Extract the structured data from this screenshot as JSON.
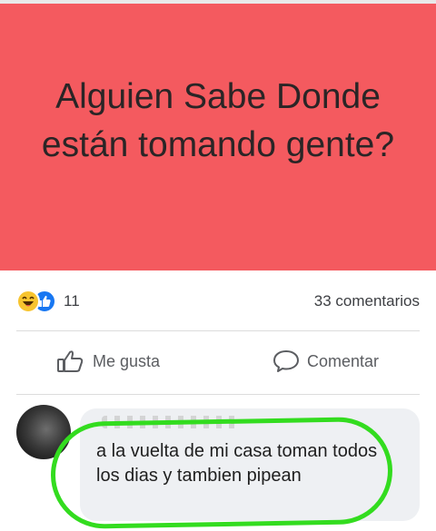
{
  "post": {
    "text": "Alguien Sabe Donde están tomando gente?",
    "background_color": "#f45a5f"
  },
  "stats": {
    "reaction_icons": [
      "haha-icon",
      "like-icon"
    ],
    "reaction_count": "11",
    "comment_count": "33 comentarios"
  },
  "actions": {
    "like_label": "Me gusta",
    "comment_label": "Comentar"
  },
  "comment": {
    "text": "a la vuelta de mi casa toman todos los dias y tambien pipean",
    "highlight_color": "#33dc1f"
  }
}
